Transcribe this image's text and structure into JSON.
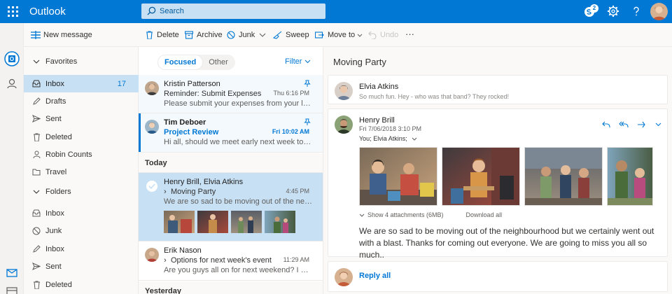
{
  "app": {
    "name": "Outlook"
  },
  "search": {
    "placeholder": "Search"
  },
  "top": {
    "notification_count": "2"
  },
  "commands": {
    "new_message": "New message",
    "delete": "Delete",
    "archive": "Archive",
    "junk": "Junk",
    "sweep": "Sweep",
    "move_to": "Move to",
    "undo": "Undo",
    "more": "···"
  },
  "nav": {
    "favorites_label": "Favorites",
    "favorites": [
      {
        "label": "Inbox",
        "count": "17",
        "icon": "inbox-icon"
      },
      {
        "label": "Drafts",
        "icon": "pencil-icon"
      },
      {
        "label": "Sent",
        "icon": "send-icon"
      },
      {
        "label": "Deleted",
        "icon": "trash-icon"
      },
      {
        "label": "Robin Counts",
        "icon": "person-icon"
      },
      {
        "label": "Travel",
        "icon": "folder-icon"
      }
    ],
    "folders_label": "Folders",
    "folders": [
      {
        "label": "Inbox",
        "icon": "inbox-icon"
      },
      {
        "label": "Junk",
        "icon": "junk-icon"
      },
      {
        "label": "Inbox",
        "icon": "pencil-icon"
      },
      {
        "label": "Sent",
        "icon": "send-icon"
      },
      {
        "label": "Deleted",
        "icon": "trash-icon"
      }
    ]
  },
  "list": {
    "pivot_focused": "Focused",
    "pivot_other": "Other",
    "filter": "Filter",
    "messages": [
      {
        "sender": "Kristin Patterson",
        "subject": "Reminder: Submit Expenses",
        "time": "Thu 6:16 PM",
        "preview": "Please submit your expenses from your last..."
      },
      {
        "sender": "Tim Deboer",
        "subject": "Project Review",
        "time": "Fri 10:02 AM",
        "preview": "Hi all, should we meet early next week to di..."
      }
    ],
    "group_today": "Today",
    "today": [
      {
        "sender": "Henry Brill, Elvia Atkins",
        "subject": "Moving Party",
        "time": "4:45 PM",
        "preview": "We are so sad to be moving out of the nei..."
      },
      {
        "sender": "Erik Nason",
        "subject": "Options for next week's event",
        "time": "11:29 AM",
        "preview": "Are you guys all on for next weekend? I was..."
      }
    ],
    "group_yesterday": "Yesterday"
  },
  "reading": {
    "title": "Moving Party",
    "first": {
      "name": "Elvia Atkins",
      "snippet": "So much fun. Hey - who was that band? They rocked!"
    },
    "main": {
      "name": "Henry Brill",
      "date": "Fri 7/06/2018 3:10 PM",
      "to": "You; Elvia Atkins;",
      "show_attachments": "Show 4 attachments (6MB)",
      "download_all": "Download all",
      "body": "We are so sad to be moving out of the neighbourhood but we certainly went out with a blast. Thanks for coming out everyone. We are going to miss you all so much.."
    },
    "reply_all": "Reply all"
  },
  "colors": {
    "accent": "#0078d4",
    "selected": "#c7e0f4"
  }
}
